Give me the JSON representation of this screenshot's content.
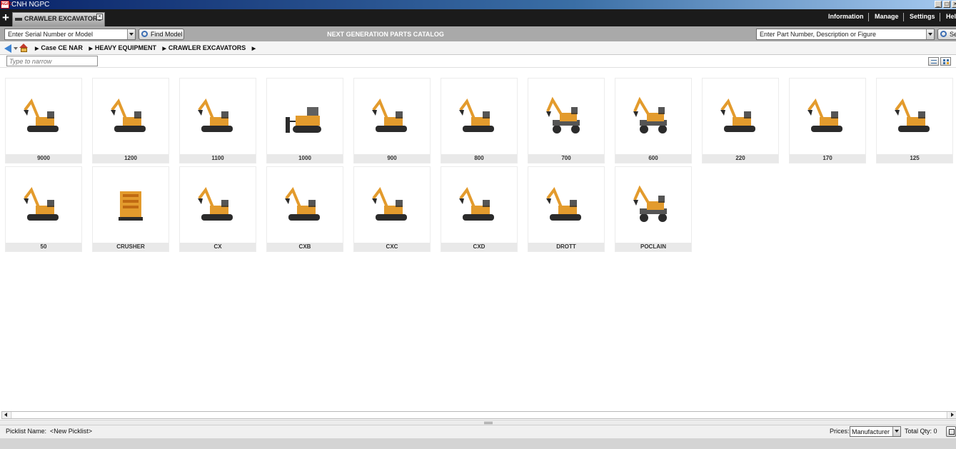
{
  "window": {
    "title": "CNH NGPC",
    "app_icon_text": "NGPC"
  },
  "tabbar": {
    "new_tab_glyph": "+",
    "active_tab": "CRAWLER EXCAVATORS",
    "tab_close_glyph": "×",
    "menu": [
      "Information",
      "Manage",
      "Settings",
      "Help"
    ]
  },
  "searchbar": {
    "model_search_value": "Enter Serial Number or Model",
    "find_model_label": "Find Model",
    "catalog_title": "NEXT GENERATION PARTS CATALOG",
    "part_search_value": "Enter Part Number, Description or Figure",
    "search_label": "Search"
  },
  "breadcrumb": [
    "Case CE NAR",
    "HEAVY EQUIPMENT",
    "CRAWLER EXCAVATORS"
  ],
  "filter": {
    "placeholder": "Type to narrow"
  },
  "models": [
    {
      "label": "9000",
      "icon": "excavator-icon",
      "kind": "excavator"
    },
    {
      "label": "1200",
      "icon": "excavator-icon",
      "kind": "excavator"
    },
    {
      "label": "1100",
      "icon": "excavator-icon",
      "kind": "excavator"
    },
    {
      "label": "1000",
      "icon": "dozer-icon",
      "kind": "dozer"
    },
    {
      "label": "900",
      "icon": "excavator-icon",
      "kind": "excavator"
    },
    {
      "label": "800",
      "icon": "excavator-icon",
      "kind": "excavator"
    },
    {
      "label": "700",
      "icon": "wheeled-excavator-icon",
      "kind": "wheeled"
    },
    {
      "label": "600",
      "icon": "wheeled-excavator-icon",
      "kind": "wheeled"
    },
    {
      "label": "220",
      "icon": "excavator-icon",
      "kind": "excavator"
    },
    {
      "label": "170",
      "icon": "excavator-icon",
      "kind": "excavator"
    },
    {
      "label": "125",
      "icon": "excavator-icon",
      "kind": "excavator"
    },
    {
      "label": "50",
      "icon": "excavator-icon",
      "kind": "excavator"
    },
    {
      "label": "CRUSHER",
      "icon": "crusher-icon",
      "kind": "crusher"
    },
    {
      "label": "CX",
      "icon": "excavator-icon",
      "kind": "excavator"
    },
    {
      "label": "CXB",
      "icon": "excavator-icon",
      "kind": "excavator"
    },
    {
      "label": "CXC",
      "icon": "excavator-icon",
      "kind": "excavator"
    },
    {
      "label": "CXD",
      "icon": "excavator-icon",
      "kind": "excavator"
    },
    {
      "label": "DROTT",
      "icon": "excavator-icon",
      "kind": "excavator"
    },
    {
      "label": "POCLAIN",
      "icon": "wheeled-excavator-icon",
      "kind": "wheeled"
    }
  ],
  "picklist": {
    "name_label": "Picklist Name:",
    "name_value": "<New Picklist>",
    "prices_label": "Prices:",
    "prices_value": "Manufacturer",
    "total_qty": "Total Qty: 0"
  },
  "colors": {
    "machine_yellow": "#e39b2d",
    "machine_dark": "#2b2b2b",
    "tab_bar": "#1b1b1b",
    "search_bar": "#a9a9a9"
  }
}
